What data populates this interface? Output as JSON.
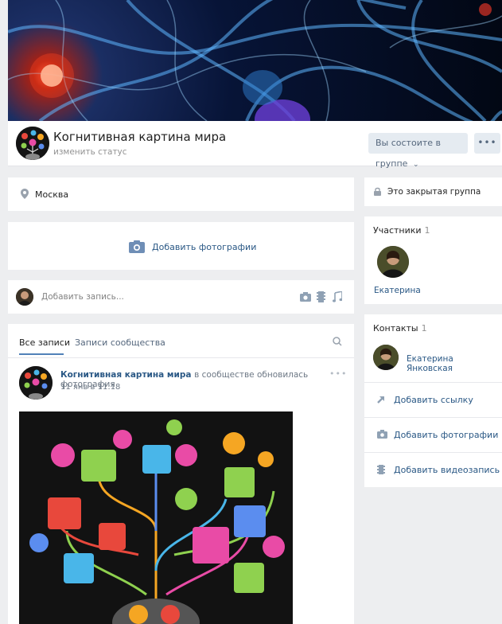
{
  "header": {
    "group_name": "Когнитивная картина мира",
    "status_link": "изменить статус",
    "member_button": "Вы состоите в группе",
    "more_button": "•••"
  },
  "info": {
    "location": "Москва"
  },
  "add_photos": {
    "label": "Добавить фотографии"
  },
  "composer": {
    "placeholder": "Добавить запись..."
  },
  "wall_tabs": {
    "all_posts": "Все записи",
    "community_posts": "Записи сообщества"
  },
  "post": {
    "author": "Когнитивная картина мира",
    "action": "в сообществе обновилась фотография",
    "date": "11 янв в 11:18",
    "more": "•••"
  },
  "sidebar": {
    "closed_group": "Это закрытая группа",
    "members": {
      "title": "Участники",
      "count": "1",
      "member_name": "Екатерина"
    },
    "contacts": {
      "title": "Контакты",
      "count": "1",
      "contact_name": "Екатерина Янковская"
    },
    "links": {
      "add_link": "Добавить ссылку",
      "add_photos": "Добавить фотографии",
      "add_video": "Добавить видеозапись"
    }
  },
  "colors": {
    "link": "#2a5885",
    "accent": "#5181b8",
    "background": "#edeef0",
    "button_bg": "#e5ebf1"
  },
  "icons": [
    "location-pin-icon",
    "camera-icon",
    "video-icon",
    "music-icon",
    "search-icon",
    "lock-icon",
    "link-arrow-icon",
    "chevron-down-icon"
  ]
}
